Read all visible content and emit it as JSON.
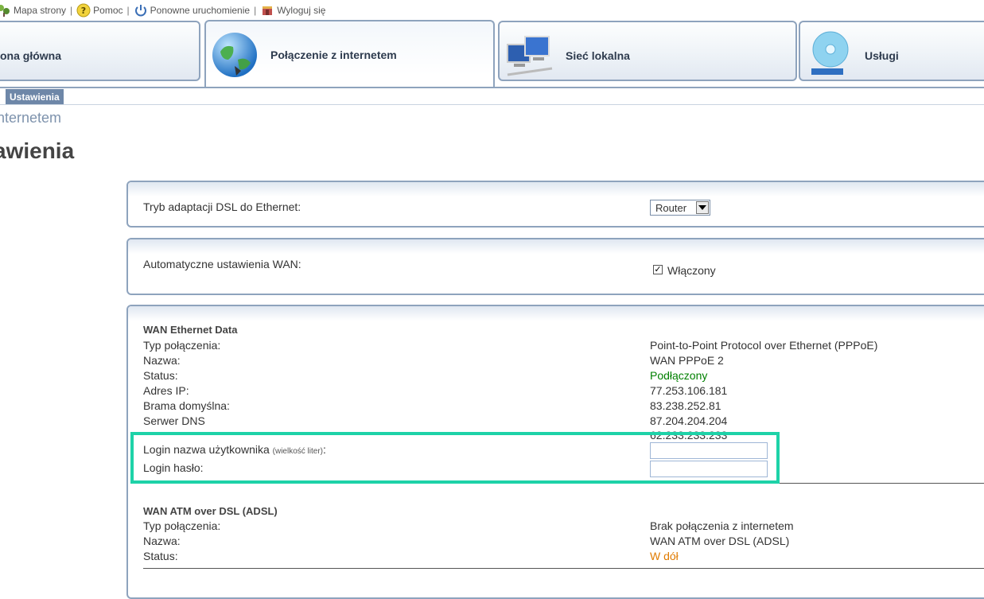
{
  "topbar": {
    "sitemap": "Mapa strony",
    "help": "Pomoc",
    "restart": "Ponowne uruchomienie",
    "logout": "Wyloguj się",
    "separator": "|"
  },
  "tabs": [
    {
      "label": "ona główna"
    },
    {
      "label": "Połączenie z internetem"
    },
    {
      "label": "Sieć lokalna"
    },
    {
      "label": "Usługi"
    }
  ],
  "subtab": "Ustawienia",
  "breadcrumb": "nternetem",
  "page_title": "awienia",
  "dsl_panel": {
    "label": "Tryb adaptacji DSL do Ethernet:",
    "select_value": "Router"
  },
  "wan_auto_panel": {
    "label": "Automatyczne ustawienia WAN:",
    "checkbox_label": "Włączony",
    "checked": true
  },
  "wan_ethernet": {
    "title": "WAN Ethernet Data",
    "rows": [
      {
        "label": "Typ połączenia:",
        "value": "Point-to-Point Protocol over Ethernet (PPPoE)"
      },
      {
        "label": "Nazwa:",
        "value": "WAN PPPoE 2"
      },
      {
        "label": "Status:",
        "value": "Podłączony"
      },
      {
        "label": "Adres IP:",
        "value": "77.253.106.181"
      },
      {
        "label": "Brama domyślna:",
        "value": "83.238.252.81"
      },
      {
        "label": "Serwer DNS",
        "value": "87.204.204.204"
      }
    ],
    "dns_secondary": "62.233.233.233",
    "login_user_label": "Login nazwa użytkownika",
    "login_user_hint": "(wielkość liter)",
    "login_user_colon": ":",
    "login_pass_label": "Login hasło:",
    "login_user_value": "",
    "login_pass_value": ""
  },
  "wan_atm": {
    "title": "WAN ATM over DSL (ADSL)",
    "rows": [
      {
        "label": "Typ połączenia:",
        "value": "Brak połączenia z internetem"
      },
      {
        "label": "Nazwa:",
        "value": "WAN ATM over DSL (ADSL)"
      },
      {
        "label": "Status:",
        "value": "W dół"
      }
    ]
  },
  "colors": {
    "status_connected": "#008000",
    "status_down": "#e07b00",
    "highlight": "#1ed2a8",
    "tab_border": "#8ea3bd"
  }
}
